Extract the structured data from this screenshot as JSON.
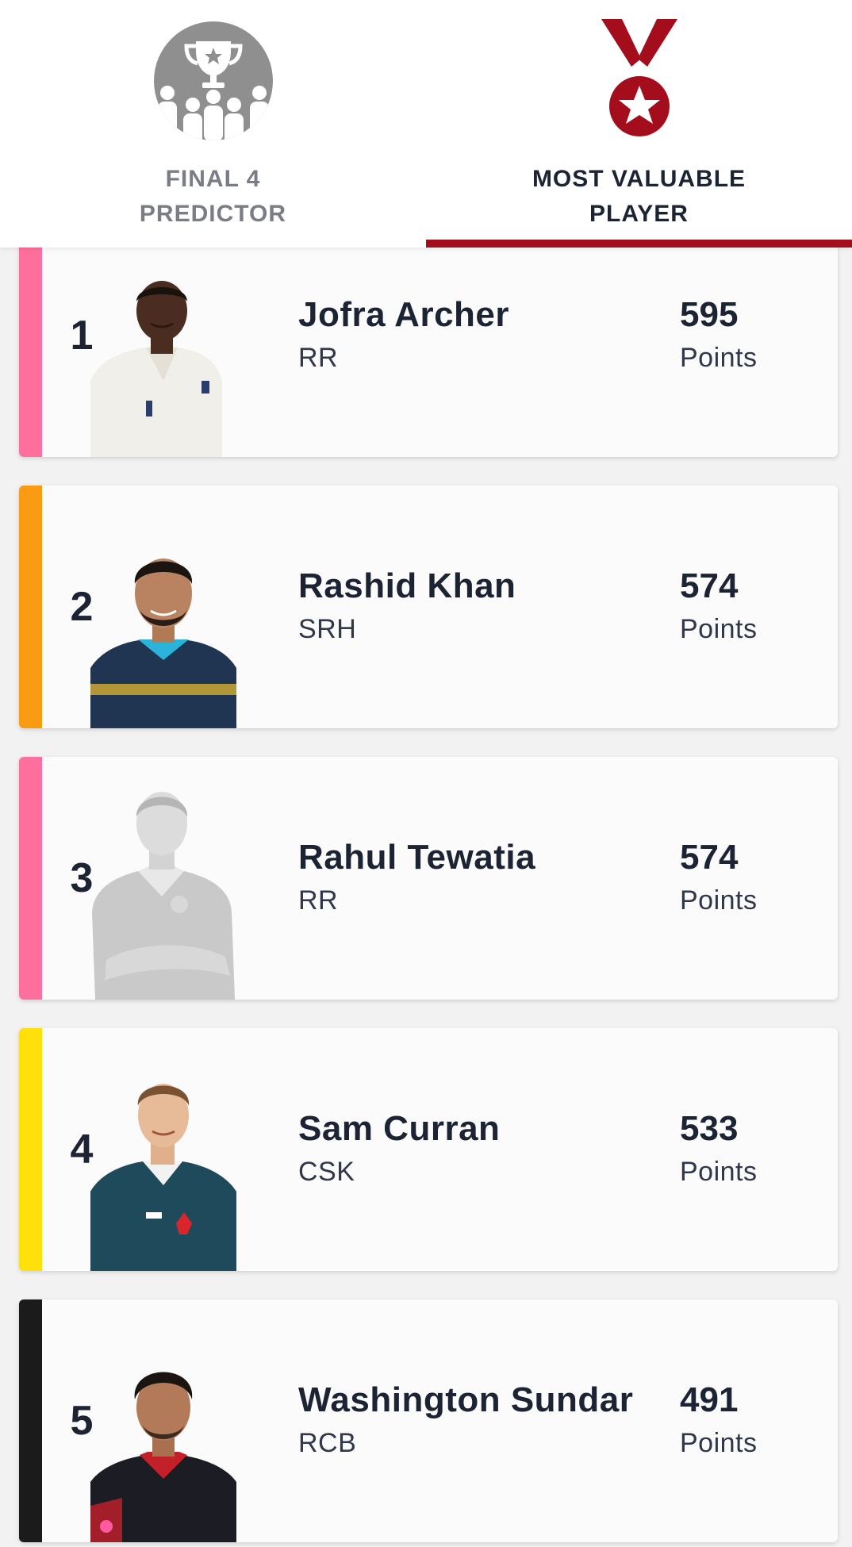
{
  "tabs": [
    {
      "label": "FINAL 4 PREDICTOR",
      "icon": "trophy-group-icon",
      "active": false
    },
    {
      "label": "MOST VALUABLE PLAYER",
      "icon": "medal-icon",
      "active": true
    }
  ],
  "players": [
    {
      "rank": "1",
      "name": "Jofra Archer",
      "team": "RR",
      "points": "595",
      "points_unit": "Points",
      "stripe_color": "#ff6f9d"
    },
    {
      "rank": "2",
      "name": "Rashid Khan",
      "team": "SRH",
      "points": "574",
      "points_unit": "Points",
      "stripe_color": "#f99b13"
    },
    {
      "rank": "3",
      "name": "Rahul Tewatia",
      "team": "RR",
      "points": "574",
      "points_unit": "Points",
      "stripe_color": "#ff6f9d"
    },
    {
      "rank": "4",
      "name": "Sam Curran",
      "team": "CSK",
      "points": "533",
      "points_unit": "Points",
      "stripe_color": "#ffe00a"
    },
    {
      "rank": "5",
      "name": "Washington Sundar",
      "team": "RCB",
      "points": "491",
      "points_unit": "Points",
      "stripe_color": "#1b1b1b"
    }
  ],
  "colors": {
    "accent": "#a30d1c",
    "inactive_icon": "#8f8f8f"
  }
}
